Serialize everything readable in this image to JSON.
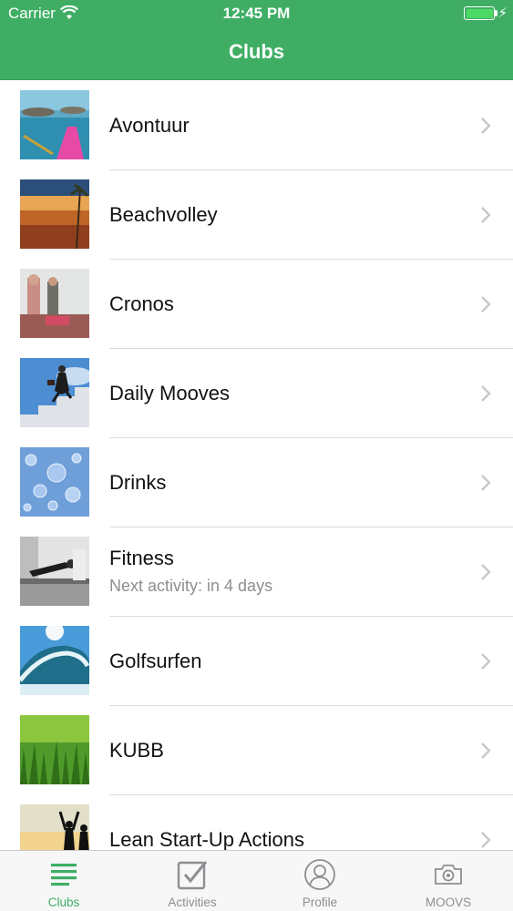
{
  "status_bar": {
    "carrier": "Carrier",
    "time": "12:45 PM",
    "battery_level": 1.0
  },
  "nav": {
    "title": "Clubs"
  },
  "clubs": [
    {
      "name": "Avontuur",
      "subtitle": "",
      "thumb_icon": "kayak-lake-photo"
    },
    {
      "name": "Beachvolley",
      "subtitle": "",
      "thumb_icon": "beach-sunset-photo"
    },
    {
      "name": "Cronos",
      "subtitle": "",
      "thumb_icon": "party-people-photo"
    },
    {
      "name": "Daily Mooves",
      "subtitle": "",
      "thumb_icon": "businessman-stairs-photo"
    },
    {
      "name": "Drinks",
      "subtitle": "",
      "thumb_icon": "bubbles-photo"
    },
    {
      "name": "Fitness",
      "subtitle": "Next activity: in 4 days",
      "thumb_icon": "plank-exercise-photo"
    },
    {
      "name": "Golfsurfen",
      "subtitle": "",
      "thumb_icon": "wave-photo"
    },
    {
      "name": "KUBB",
      "subtitle": "",
      "thumb_icon": "grass-photo"
    },
    {
      "name": "Lean Start-Up Actions",
      "subtitle": "",
      "thumb_icon": "celebrating-people-photo"
    }
  ],
  "tabs": [
    {
      "label": "Clubs",
      "icon": "list-icon",
      "active": true
    },
    {
      "label": "Activities",
      "icon": "checkbox-icon",
      "active": false
    },
    {
      "label": "Profile",
      "icon": "person-icon",
      "active": false
    },
    {
      "label": "MOOVS",
      "icon": "camera-icon",
      "active": false
    }
  ],
  "colors": {
    "brand_green": "#3fae64",
    "separator": "#dcdcdf",
    "chevron": "#c7c7cc",
    "inactive_tab": "#8e8e93"
  }
}
